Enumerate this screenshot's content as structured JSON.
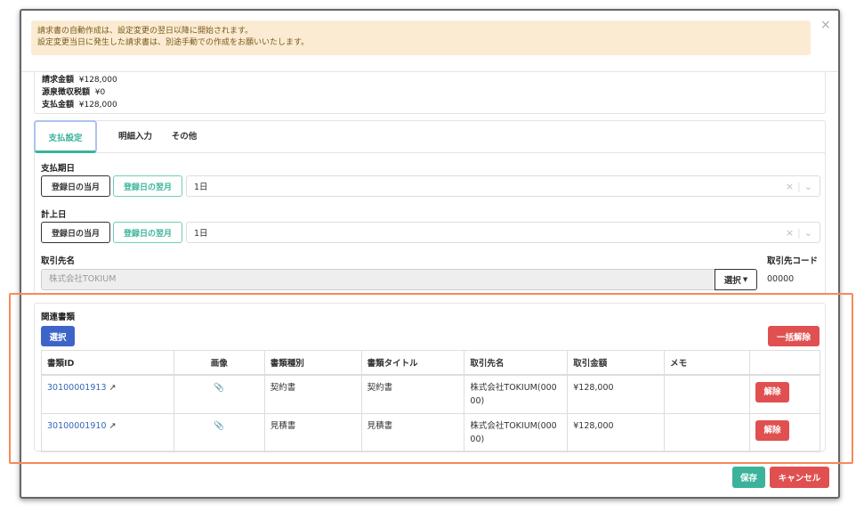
{
  "alert": {
    "line1": "請求書の自動作成は、設定変更の翌日以降に開始されます。",
    "line2": "設定変更当日に発生した請求書は、別途手動での作成をお願いいたします。"
  },
  "close": "×",
  "summary": {
    "billing_label": "請求金額",
    "billing_value": "¥128,000",
    "withholding_label": "源泉徴収税額",
    "withholding_value": "¥0",
    "payment_label": "支払金額",
    "payment_value": "¥128,000"
  },
  "tabs": [
    "支払設定",
    "明細入力",
    "その他"
  ],
  "due_date": {
    "label": "支払期日",
    "btn_this_month": "登録日の当月",
    "btn_next_month": "登録日の翌月",
    "value": "1日"
  },
  "posting_date": {
    "label": "計上日",
    "btn_this_month": "登録日の当月",
    "btn_next_month": "登録日の翌月",
    "value": "1日"
  },
  "partner": {
    "label": "取引先名",
    "value": "株式会社TOKIUM",
    "select_label": "選択",
    "code_label": "取引先コード",
    "code_value": "00000"
  },
  "related": {
    "title": "関連書類",
    "select_label": "選択",
    "bulk_remove_label": "一括解除",
    "columns": [
      "書類ID",
      "画像",
      "書類種別",
      "書類タイトル",
      "取引先名",
      "取引金額",
      "メモ",
      ""
    ],
    "rows": [
      {
        "id": "30100001913",
        "type": "契約書",
        "title": "契約書",
        "partner": "株式会社TOKIUM(00000)",
        "amount": "¥128,000",
        "memo": "",
        "remove": "解除"
      },
      {
        "id": "30100001910",
        "type": "見積書",
        "title": "見積書",
        "partner": "株式会社TOKIUM(00000)",
        "amount": "¥128,000",
        "memo": "",
        "remove": "解除"
      }
    ]
  },
  "footer": {
    "save": "保存",
    "cancel": "キャンセル"
  }
}
